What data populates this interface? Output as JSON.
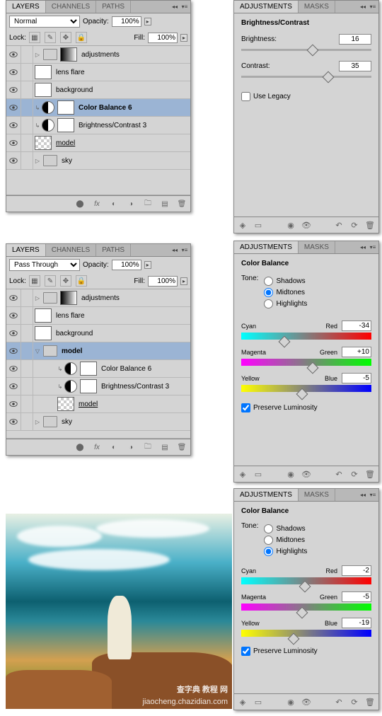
{
  "layers_panel": {
    "tabs": [
      "LAYERS",
      "CHANNELS",
      "PATHS"
    ],
    "blend": "Normal",
    "opacity_label": "Opacity:",
    "opacity": "100%",
    "lock_label": "Lock:",
    "fill_label": "Fill:",
    "fill": "100%",
    "layers": [
      {
        "name": "adjustments",
        "folder": true
      },
      {
        "name": "lens flare"
      },
      {
        "name": "background"
      },
      {
        "name": "Color Balance 6",
        "adj": true,
        "sel": true,
        "bold": true
      },
      {
        "name": "Brightness/Contrast 3",
        "adj": true
      },
      {
        "name": "model",
        "underline": true,
        "trans": true
      },
      {
        "name": "sky",
        "folder": true
      }
    ]
  },
  "layers_panel2": {
    "tabs": [
      "LAYERS",
      "CHANNELS",
      "PATHS"
    ],
    "blend": "Pass Through",
    "opacity_label": "Opacity:",
    "opacity": "100%",
    "lock_label": "Lock:",
    "fill_label": "Fill:",
    "fill": "100%",
    "layers": [
      {
        "name": "adjustments",
        "folder": true
      },
      {
        "name": "lens flare"
      },
      {
        "name": "background"
      },
      {
        "name": "model",
        "folder": true,
        "sel": true,
        "open": true,
        "bold": true
      },
      {
        "name": "Color Balance 6",
        "adj": true,
        "child": true
      },
      {
        "name": "Brightness/Contrast 3",
        "adj": true,
        "child": true
      },
      {
        "name": "model",
        "underline": true,
        "trans": true,
        "child": true
      },
      {
        "name": "sky",
        "folder": true
      }
    ]
  },
  "bc": {
    "tabs": [
      "ADJUSTMENTS",
      "MASKS"
    ],
    "title": "Brightness/Contrast",
    "brightness_label": "Brightness:",
    "brightness": "16",
    "contrast_label": "Contrast:",
    "contrast": "35",
    "legacy": "Use Legacy"
  },
  "cb1": {
    "tabs": [
      "ADJUSTMENTS",
      "MASKS"
    ],
    "title": "Color Balance",
    "tone": "Tone:",
    "shadows": "Shadows",
    "midtones": "Midtones",
    "highlights": "Highlights",
    "sel": "midtones",
    "lab": {
      "cy": "Cyan",
      "rd": "Red",
      "mg": "Magenta",
      "gr": "Green",
      "yl": "Yellow",
      "bl": "Blue"
    },
    "v1": "-34",
    "v2": "+10",
    "v3": "-5",
    "preserve": "Preserve Luminosity"
  },
  "cb2": {
    "tabs": [
      "ADJUSTMENTS",
      "MASKS"
    ],
    "title": "Color Balance",
    "tone": "Tone:",
    "shadows": "Shadows",
    "midtones": "Midtones",
    "highlights": "Highlights",
    "sel": "highlights",
    "lab": {
      "cy": "Cyan",
      "rd": "Red",
      "mg": "Magenta",
      "gr": "Green",
      "yl": "Yellow",
      "bl": "Blue"
    },
    "v1": "-2",
    "v2": "-5",
    "v3": "-19",
    "preserve": "Preserve Luminosity"
  },
  "wm1": "查字典 教程 网",
  "wm2": "jiaocheng.chazidian.com"
}
